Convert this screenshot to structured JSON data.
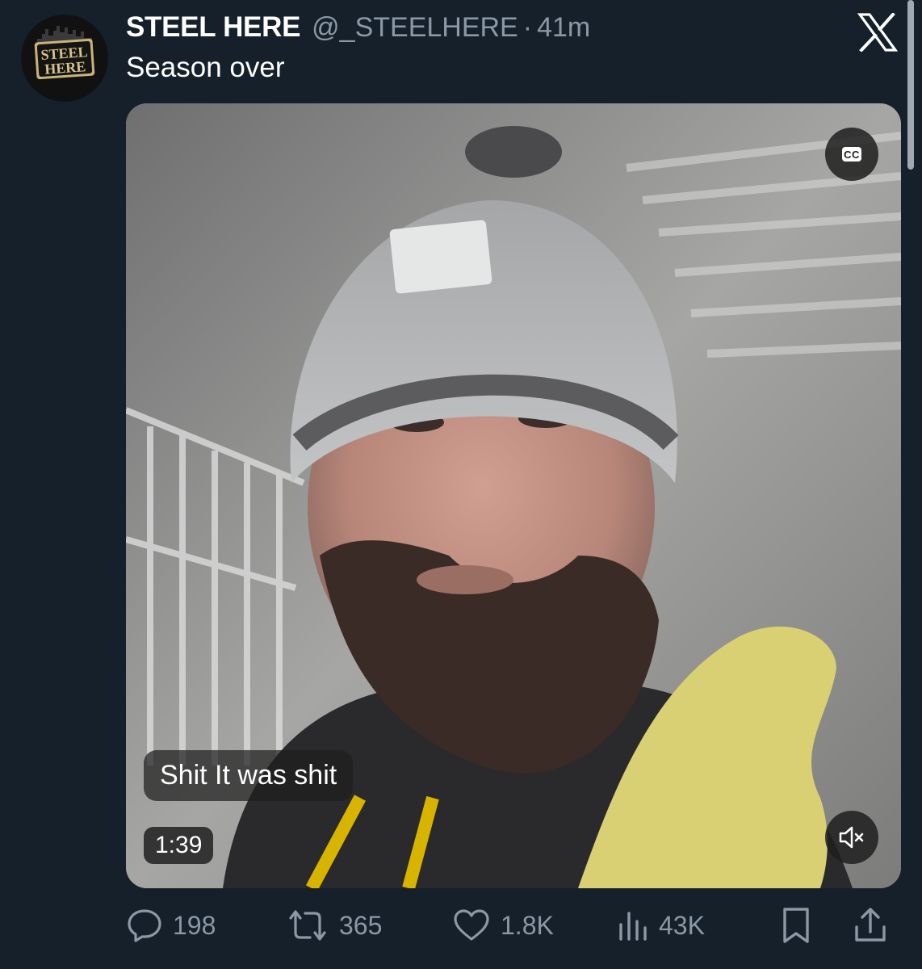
{
  "tweet": {
    "author": {
      "display_name": "STEEL HERE",
      "handle": "@_STEELHERE",
      "avatar_text_line1": "STEEL",
      "avatar_text_line2": "HERE"
    },
    "separator": "·",
    "time": "41m",
    "text": "Season over",
    "media": {
      "type": "video",
      "caption": "Shit It was shit",
      "duration": "1:39",
      "cc_label": "CC",
      "muted": true
    },
    "metrics": {
      "replies": "198",
      "retweets": "365",
      "likes": "1.8K",
      "views": "43K"
    }
  },
  "icons": {
    "platform_logo": "x-logo-icon",
    "closed_captions": "cc-icon",
    "mute": "speaker-muted-icon",
    "reply": "reply-icon",
    "retweet": "retweet-icon",
    "like": "heart-icon",
    "views": "views-icon",
    "bookmark": "bookmark-icon",
    "share": "share-icon"
  },
  "colors": {
    "background": "#15202b",
    "secondary_text": "#8b98a5",
    "primary_text": "#ffffff",
    "avatar_gold": "#c9b37a"
  }
}
